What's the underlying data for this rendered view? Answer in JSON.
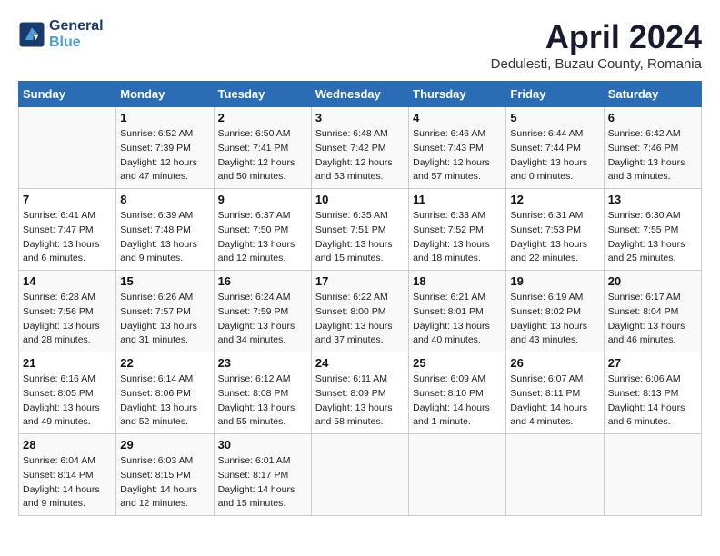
{
  "header": {
    "logo_line1": "General",
    "logo_line2": "Blue",
    "month": "April 2024",
    "location": "Dedulesti, Buzau County, Romania"
  },
  "days_of_week": [
    "Sunday",
    "Monday",
    "Tuesday",
    "Wednesday",
    "Thursday",
    "Friday",
    "Saturday"
  ],
  "weeks": [
    [
      {
        "day": "",
        "sunrise": "",
        "sunset": "",
        "daylight": ""
      },
      {
        "day": "1",
        "sunrise": "Sunrise: 6:52 AM",
        "sunset": "Sunset: 7:39 PM",
        "daylight": "Daylight: 12 hours and 47 minutes."
      },
      {
        "day": "2",
        "sunrise": "Sunrise: 6:50 AM",
        "sunset": "Sunset: 7:41 PM",
        "daylight": "Daylight: 12 hours and 50 minutes."
      },
      {
        "day": "3",
        "sunrise": "Sunrise: 6:48 AM",
        "sunset": "Sunset: 7:42 PM",
        "daylight": "Daylight: 12 hours and 53 minutes."
      },
      {
        "day": "4",
        "sunrise": "Sunrise: 6:46 AM",
        "sunset": "Sunset: 7:43 PM",
        "daylight": "Daylight: 12 hours and 57 minutes."
      },
      {
        "day": "5",
        "sunrise": "Sunrise: 6:44 AM",
        "sunset": "Sunset: 7:44 PM",
        "daylight": "Daylight: 13 hours and 0 minutes."
      },
      {
        "day": "6",
        "sunrise": "Sunrise: 6:42 AM",
        "sunset": "Sunset: 7:46 PM",
        "daylight": "Daylight: 13 hours and 3 minutes."
      }
    ],
    [
      {
        "day": "7",
        "sunrise": "Sunrise: 6:41 AM",
        "sunset": "Sunset: 7:47 PM",
        "daylight": "Daylight: 13 hours and 6 minutes."
      },
      {
        "day": "8",
        "sunrise": "Sunrise: 6:39 AM",
        "sunset": "Sunset: 7:48 PM",
        "daylight": "Daylight: 13 hours and 9 minutes."
      },
      {
        "day": "9",
        "sunrise": "Sunrise: 6:37 AM",
        "sunset": "Sunset: 7:50 PM",
        "daylight": "Daylight: 13 hours and 12 minutes."
      },
      {
        "day": "10",
        "sunrise": "Sunrise: 6:35 AM",
        "sunset": "Sunset: 7:51 PM",
        "daylight": "Daylight: 13 hours and 15 minutes."
      },
      {
        "day": "11",
        "sunrise": "Sunrise: 6:33 AM",
        "sunset": "Sunset: 7:52 PM",
        "daylight": "Daylight: 13 hours and 18 minutes."
      },
      {
        "day": "12",
        "sunrise": "Sunrise: 6:31 AM",
        "sunset": "Sunset: 7:53 PM",
        "daylight": "Daylight: 13 hours and 22 minutes."
      },
      {
        "day": "13",
        "sunrise": "Sunrise: 6:30 AM",
        "sunset": "Sunset: 7:55 PM",
        "daylight": "Daylight: 13 hours and 25 minutes."
      }
    ],
    [
      {
        "day": "14",
        "sunrise": "Sunrise: 6:28 AM",
        "sunset": "Sunset: 7:56 PM",
        "daylight": "Daylight: 13 hours and 28 minutes."
      },
      {
        "day": "15",
        "sunrise": "Sunrise: 6:26 AM",
        "sunset": "Sunset: 7:57 PM",
        "daylight": "Daylight: 13 hours and 31 minutes."
      },
      {
        "day": "16",
        "sunrise": "Sunrise: 6:24 AM",
        "sunset": "Sunset: 7:59 PM",
        "daylight": "Daylight: 13 hours and 34 minutes."
      },
      {
        "day": "17",
        "sunrise": "Sunrise: 6:22 AM",
        "sunset": "Sunset: 8:00 PM",
        "daylight": "Daylight: 13 hours and 37 minutes."
      },
      {
        "day": "18",
        "sunrise": "Sunrise: 6:21 AM",
        "sunset": "Sunset: 8:01 PM",
        "daylight": "Daylight: 13 hours and 40 minutes."
      },
      {
        "day": "19",
        "sunrise": "Sunrise: 6:19 AM",
        "sunset": "Sunset: 8:02 PM",
        "daylight": "Daylight: 13 hours and 43 minutes."
      },
      {
        "day": "20",
        "sunrise": "Sunrise: 6:17 AM",
        "sunset": "Sunset: 8:04 PM",
        "daylight": "Daylight: 13 hours and 46 minutes."
      }
    ],
    [
      {
        "day": "21",
        "sunrise": "Sunrise: 6:16 AM",
        "sunset": "Sunset: 8:05 PM",
        "daylight": "Daylight: 13 hours and 49 minutes."
      },
      {
        "day": "22",
        "sunrise": "Sunrise: 6:14 AM",
        "sunset": "Sunset: 8:06 PM",
        "daylight": "Daylight: 13 hours and 52 minutes."
      },
      {
        "day": "23",
        "sunrise": "Sunrise: 6:12 AM",
        "sunset": "Sunset: 8:08 PM",
        "daylight": "Daylight: 13 hours and 55 minutes."
      },
      {
        "day": "24",
        "sunrise": "Sunrise: 6:11 AM",
        "sunset": "Sunset: 8:09 PM",
        "daylight": "Daylight: 13 hours and 58 minutes."
      },
      {
        "day": "25",
        "sunrise": "Sunrise: 6:09 AM",
        "sunset": "Sunset: 8:10 PM",
        "daylight": "Daylight: 14 hours and 1 minute."
      },
      {
        "day": "26",
        "sunrise": "Sunrise: 6:07 AM",
        "sunset": "Sunset: 8:11 PM",
        "daylight": "Daylight: 14 hours and 4 minutes."
      },
      {
        "day": "27",
        "sunrise": "Sunrise: 6:06 AM",
        "sunset": "Sunset: 8:13 PM",
        "daylight": "Daylight: 14 hours and 6 minutes."
      }
    ],
    [
      {
        "day": "28",
        "sunrise": "Sunrise: 6:04 AM",
        "sunset": "Sunset: 8:14 PM",
        "daylight": "Daylight: 14 hours and 9 minutes."
      },
      {
        "day": "29",
        "sunrise": "Sunrise: 6:03 AM",
        "sunset": "Sunset: 8:15 PM",
        "daylight": "Daylight: 14 hours and 12 minutes."
      },
      {
        "day": "30",
        "sunrise": "Sunrise: 6:01 AM",
        "sunset": "Sunset: 8:17 PM",
        "daylight": "Daylight: 14 hours and 15 minutes."
      },
      {
        "day": "",
        "sunrise": "",
        "sunset": "",
        "daylight": ""
      },
      {
        "day": "",
        "sunrise": "",
        "sunset": "",
        "daylight": ""
      },
      {
        "day": "",
        "sunrise": "",
        "sunset": "",
        "daylight": ""
      },
      {
        "day": "",
        "sunrise": "",
        "sunset": "",
        "daylight": ""
      }
    ]
  ]
}
